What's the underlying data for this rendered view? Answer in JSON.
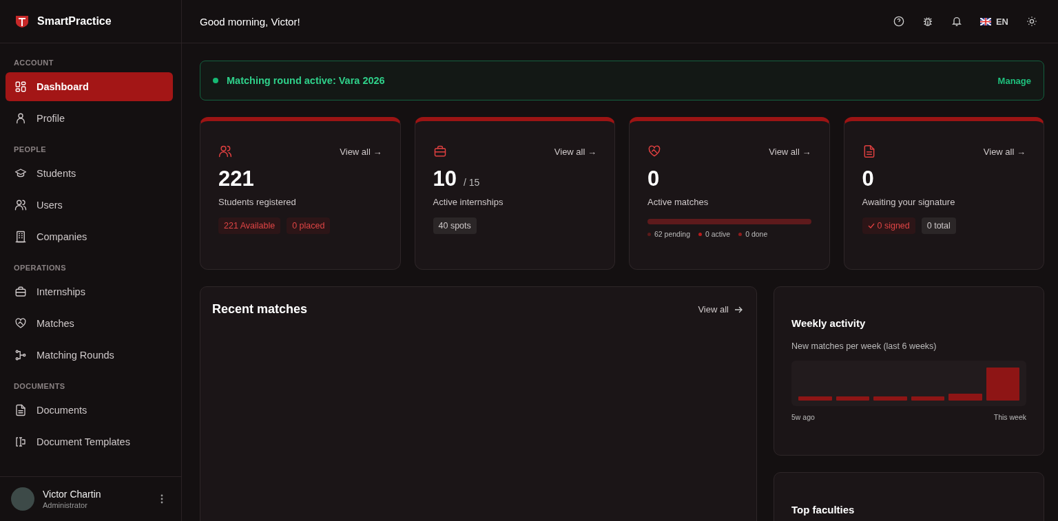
{
  "brand": {
    "name": "SmartPractice"
  },
  "sidebar": {
    "sections": [
      {
        "title": "ACCOUNT",
        "items": [
          {
            "label": "Dashboard",
            "selected": true
          },
          {
            "label": "Profile",
            "selected": false
          }
        ]
      },
      {
        "title": "PEOPLE",
        "items": [
          {
            "label": "Students",
            "selected": false
          },
          {
            "label": "Users",
            "selected": false
          },
          {
            "label": "Companies",
            "selected": false
          }
        ]
      },
      {
        "title": "OPERATIONS",
        "items": [
          {
            "label": "Internships",
            "selected": false
          },
          {
            "label": "Matches",
            "selected": false
          },
          {
            "label": "Matching Rounds",
            "selected": false
          }
        ]
      },
      {
        "title": "DOCUMENTS",
        "items": [
          {
            "label": "Documents",
            "selected": false
          },
          {
            "label": "Document Templates",
            "selected": false
          }
        ]
      }
    ],
    "user": {
      "name": "Victor Chartin",
      "role": "Administrator"
    }
  },
  "header": {
    "greeting": "Good morning, Victor!",
    "language": "EN"
  },
  "banner": {
    "text": "Matching round active: Vara 2026",
    "action": "Manage"
  },
  "stats": [
    {
      "link": "View all →",
      "value": "221",
      "label": "Students registered",
      "kind": "badges",
      "badges": [
        {
          "text": "221 Available",
          "kind": "accent",
          "check": false
        },
        {
          "text": "0 placed",
          "kind": "accent",
          "check": false
        }
      ]
    },
    {
      "link": "View all →",
      "value": "10",
      "suffix": "/ 15",
      "label": "Active internships",
      "kind": "badges",
      "badges": [
        {
          "text": "40 spots",
          "kind": "neutral",
          "check": false
        }
      ]
    },
    {
      "link": "View all →",
      "value": "0",
      "label": "Active matches",
      "kind": "progress",
      "legend": [
        {
          "text": "62 pending",
          "color": "#5c1a1a"
        },
        {
          "text": "0 active",
          "color": "#b91c1c"
        },
        {
          "text": "0 done",
          "color": "#8f1d1d"
        }
      ]
    },
    {
      "link": "View all →",
      "value": "0",
      "label": "Awaiting your signature",
      "kind": "badges",
      "badges": [
        {
          "text": "0 signed",
          "kind": "accent",
          "check": true
        },
        {
          "text": "0 total",
          "kind": "neutral",
          "check": false
        }
      ]
    }
  ],
  "recent_matches": {
    "title": "Recent matches",
    "link": "View all"
  },
  "weekly_activity": {
    "title": "Weekly activity",
    "subtitle": "New matches per week (last 6 weeks)",
    "start_label": "5w ago",
    "end_label": "This week"
  },
  "top_faculties": {
    "title": "Top faculties"
  }
}
